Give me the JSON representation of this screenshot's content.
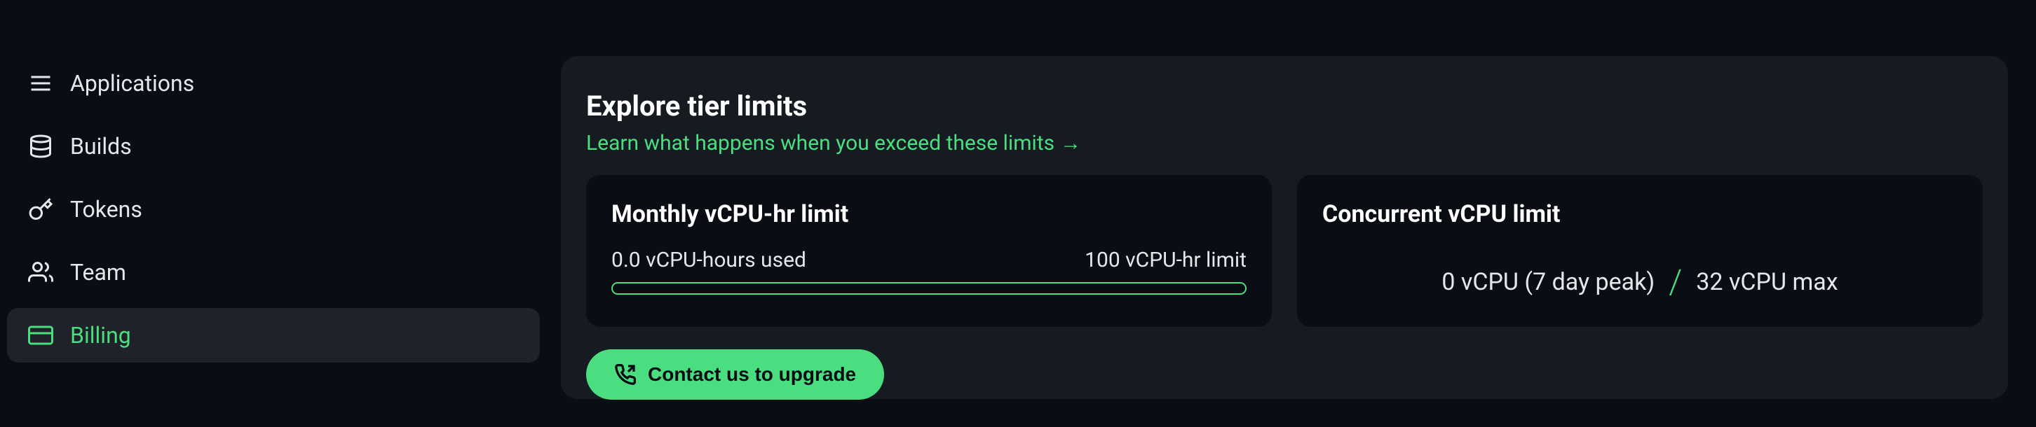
{
  "sidebar": {
    "items": [
      {
        "label": "Applications",
        "icon": "menu-icon"
      },
      {
        "label": "Builds",
        "icon": "database-icon"
      },
      {
        "label": "Tokens",
        "icon": "key-icon"
      },
      {
        "label": "Team",
        "icon": "users-icon"
      },
      {
        "label": "Billing",
        "icon": "credit-card-icon"
      }
    ],
    "active_index": 4
  },
  "main": {
    "title": "Explore tier limits",
    "learn_link": "Learn what happens when you exceed these limits",
    "arrow": "→",
    "monthly_card": {
      "title": "Monthly vCPU-hr limit",
      "used_label": "0.0 vCPU-hours used",
      "limit_label": "100 vCPU-hr limit"
    },
    "concurrent_card": {
      "title": "Concurrent vCPU limit",
      "peak_label": "0 vCPU (7 day peak)",
      "max_label": "32 vCPU max"
    },
    "upgrade_button": "Contact us to upgrade"
  },
  "colors": {
    "accent": "#4ade80",
    "background": "#0a0d14",
    "card_bg": "#161a21",
    "inner_card_bg": "#0a0d14"
  }
}
